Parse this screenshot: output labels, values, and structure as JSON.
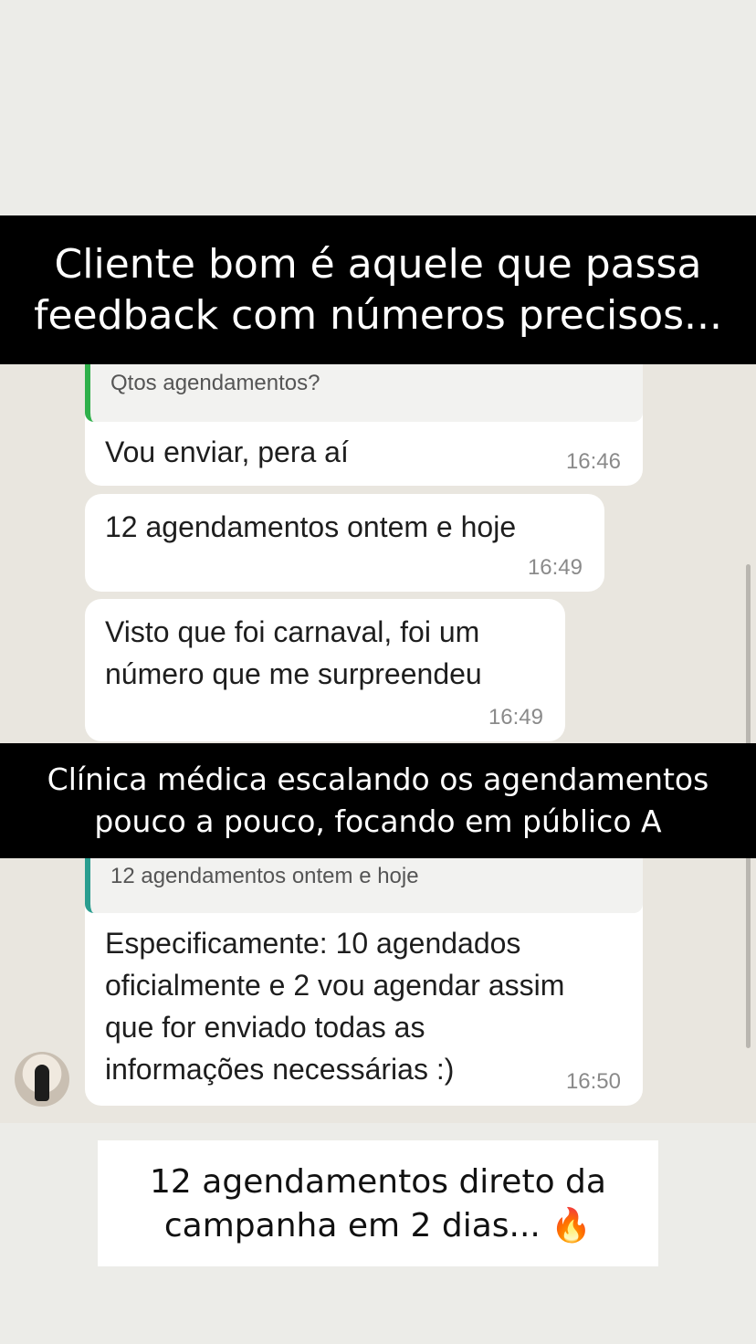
{
  "top_banner": {
    "line1": "Cliente bom é aquele que passa",
    "line2": "feedback com números precisos..."
  },
  "chat_group_1": {
    "reply_quote": "Qtos agendamentos?",
    "messages": [
      {
        "lines": [
          "Vou enviar, pera aí"
        ],
        "time": "16:46"
      },
      {
        "lines": [
          "12 agendamentos ontem e hoje"
        ],
        "time": "16:49"
      },
      {
        "lines": [
          "Visto que foi carnaval, foi um",
          "número que me surpreendeu"
        ],
        "time": "16:49"
      }
    ]
  },
  "middle_banner": {
    "line1": "Clínica médica escalando os agendamentos",
    "line2": "pouco a pouco, focando em público A"
  },
  "chat_group_2": {
    "reply_quote": "12 agendamentos ontem e hoje",
    "message": {
      "lines": [
        "Especificamente: 10 agendados",
        "oficialmente e 2 vou agendar assim",
        "que for enviado todas as",
        "informações necessárias :)"
      ],
      "time": "16:50"
    }
  },
  "caption": {
    "line1": "12 agendamentos direto da",
    "line2": "campanha em 2 dias...",
    "emoji": "🔥"
  },
  "colors": {
    "quote_bar_1": "#2fb04a",
    "quote_bar_2": "#2a9d8f",
    "banner_bg": "#000000"
  }
}
